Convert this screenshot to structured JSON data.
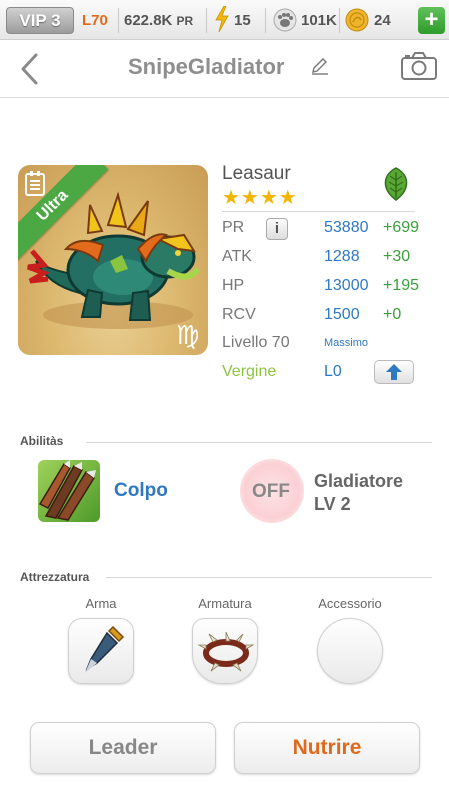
{
  "statusbar": {
    "vip": "VIP 3",
    "level": "L70",
    "power_value": "622.8K",
    "power_unit": "PR",
    "energy": "15",
    "food": "101K",
    "gold": "24",
    "add_label": "+",
    "icons": [
      "bolt-icon",
      "paw-icon",
      "coin-icon"
    ]
  },
  "header": {
    "title": "SnipeGladiator",
    "icons": [
      "back-chevron-icon",
      "pencil-icon",
      "camera-icon"
    ]
  },
  "monster": {
    "name": "Leasaur",
    "stars": "★★★★",
    "rarity": "Ultra",
    "element_icon": "leaf-icon",
    "colors": {
      "ultra_ribbon": "#4ba843",
      "stars": "#f4b400",
      "stat_value": "#2f79c2",
      "stat_bonus": "#3a9e3a"
    },
    "stats": [
      {
        "label": "PR",
        "value": "53880",
        "bonus": "+699"
      },
      {
        "label": "ATK",
        "value": "1288",
        "bonus": "+30"
      },
      {
        "label": "HP",
        "value": "13000",
        "bonus": "+195"
      },
      {
        "label": "RCV",
        "value": "1500",
        "bonus": "+0"
      }
    ],
    "info_label": "i",
    "level_label": "Livello 70",
    "level_status": "Massimo",
    "zodiac_label": "Vergine",
    "rank": "L0",
    "zodiac_icon": "virgo-icon"
  },
  "abilities": {
    "section_label": "Abilitàs",
    "skill1": {
      "name": "Colpo",
      "icon": "claw-icon"
    },
    "skill2": {
      "state": "OFF",
      "name_line1": "Gladiatore",
      "name_line2": "LV 2"
    }
  },
  "equipment": {
    "section_label": "Attrezzatura",
    "slots": [
      {
        "label": "Arma",
        "icon": "claw-weapon-icon"
      },
      {
        "label": "Armatura",
        "icon": "spiked-collar-icon"
      },
      {
        "label": "Accessorio",
        "icon": ""
      }
    ]
  },
  "actions": {
    "leader": "Leader",
    "feed": "Nutrire"
  }
}
